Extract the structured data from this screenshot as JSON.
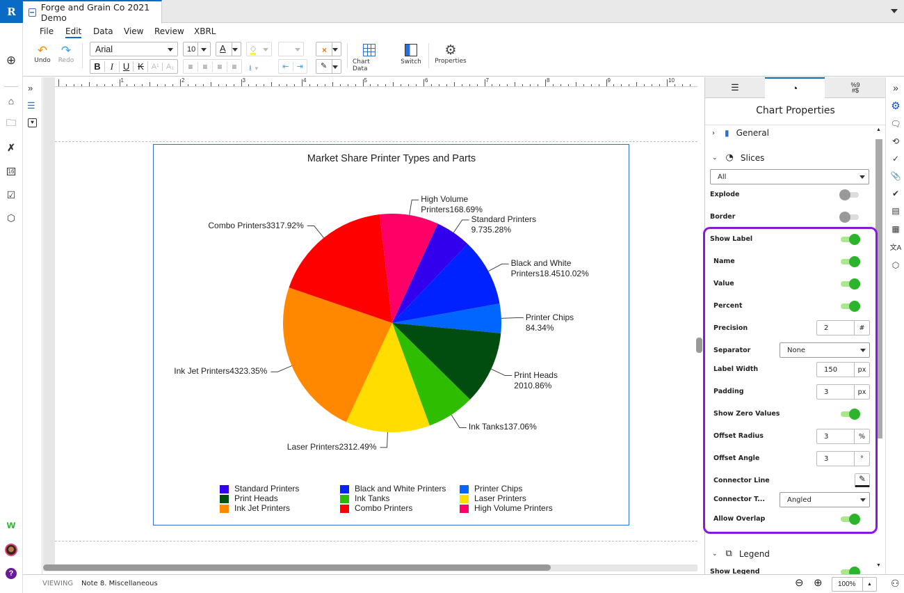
{
  "app": {
    "logo": "R",
    "document_title": "Forge and Grain Co 2021 Demo"
  },
  "menu": {
    "items": [
      "File",
      "Edit",
      "Data",
      "View",
      "Review",
      "XBRL"
    ],
    "active": "Edit"
  },
  "toolbar": {
    "undo_label": "Undo",
    "redo_label": "Redo",
    "font_family": "Arial",
    "font_size": "10",
    "chart_data_label": "Chart Data",
    "switch_label": "Switch",
    "properties_label": "Properties",
    "format_buttons": [
      "B",
      "I",
      "U",
      "K",
      "A¹",
      "A₁"
    ]
  },
  "ruler": {
    "ticks": [
      "1",
      "2",
      "3",
      "4",
      "5",
      "6",
      "7",
      "8",
      "9",
      "10"
    ]
  },
  "chart_data": {
    "type": "pie",
    "title": "Market Share Printer Types and Parts",
    "categories": [
      "Standard Printers",
      "Black and White Printers",
      "Printer Chips",
      "Print Heads",
      "Ink Tanks",
      "Laser Printers",
      "Ink Jet Printers",
      "Combo Printers",
      "High Volume Printers"
    ],
    "values": [
      9.73,
      18.45,
      8,
      20,
      13,
      23,
      43,
      33,
      16
    ],
    "percents": [
      "5.28%",
      "10.02%",
      "4.34%",
      "10.86%",
      "7.06%",
      "12.49%",
      "23.35%",
      "17.92%",
      "8.69%"
    ],
    "colors": [
      "#3300ee",
      "#0022ff",
      "#0066ff",
      "#004d0f",
      "#2ebd00",
      "#ffdd00",
      "#ff8800",
      "#ff0000",
      "#ff0066"
    ],
    "labels": [
      [
        "Standard Printers",
        "9.735.28%"
      ],
      [
        "Black and White",
        "Printers18.4510.02%"
      ],
      [
        "Printer Chips",
        "84.34%"
      ],
      [
        "Print Heads",
        "2010.86%"
      ],
      [
        "Ink Tanks137.06%"
      ],
      [
        "Laser Printers2312.49%"
      ],
      [
        "Ink Jet Printers4323.35%"
      ],
      [
        "Combo Printers3317.92%"
      ],
      [
        "High Volume",
        "Printers168.69%"
      ]
    ],
    "start_angle_deg": 24.7,
    "legend_position": "bottom",
    "legend_columns": 3
  },
  "panel": {
    "title": "Chart Properties",
    "sections": {
      "general": "General",
      "slices": "Slices",
      "legend": "Legend"
    },
    "slice_select": "All",
    "explode": {
      "label": "Explode",
      "on": false
    },
    "border": {
      "label": "Border",
      "on": false
    },
    "show_label": {
      "label": "Show Label",
      "on": true
    },
    "name": {
      "label": "Name",
      "on": true
    },
    "value": {
      "label": "Value",
      "on": true
    },
    "percent": {
      "label": "Percent",
      "on": true
    },
    "precision": {
      "label": "Precision",
      "value": "2",
      "unit": "#"
    },
    "separator": {
      "label": "Separator",
      "value": "None"
    },
    "label_width": {
      "label": "Label Width",
      "value": "150",
      "unit": "px"
    },
    "padding": {
      "label": "Padding",
      "value": "3",
      "unit": "px"
    },
    "show_zero": {
      "label": "Show Zero Values",
      "on": true
    },
    "offset_radius": {
      "label": "Offset Radius",
      "value": "3",
      "unit": "%"
    },
    "offset_angle": {
      "label": "Offset Angle",
      "value": "3",
      "unit": "°"
    },
    "connector_line": {
      "label": "Connector Line"
    },
    "connector_type": {
      "label": "Connector T...",
      "value": "Angled"
    },
    "allow_overlap": {
      "label": "Allow Overlap",
      "on": true
    },
    "show_legend": {
      "label": "Show Legend",
      "on": true
    }
  },
  "status": {
    "mode": "VIEWING",
    "section": "Note 8. Miscellaneous",
    "zoom": "100%"
  }
}
